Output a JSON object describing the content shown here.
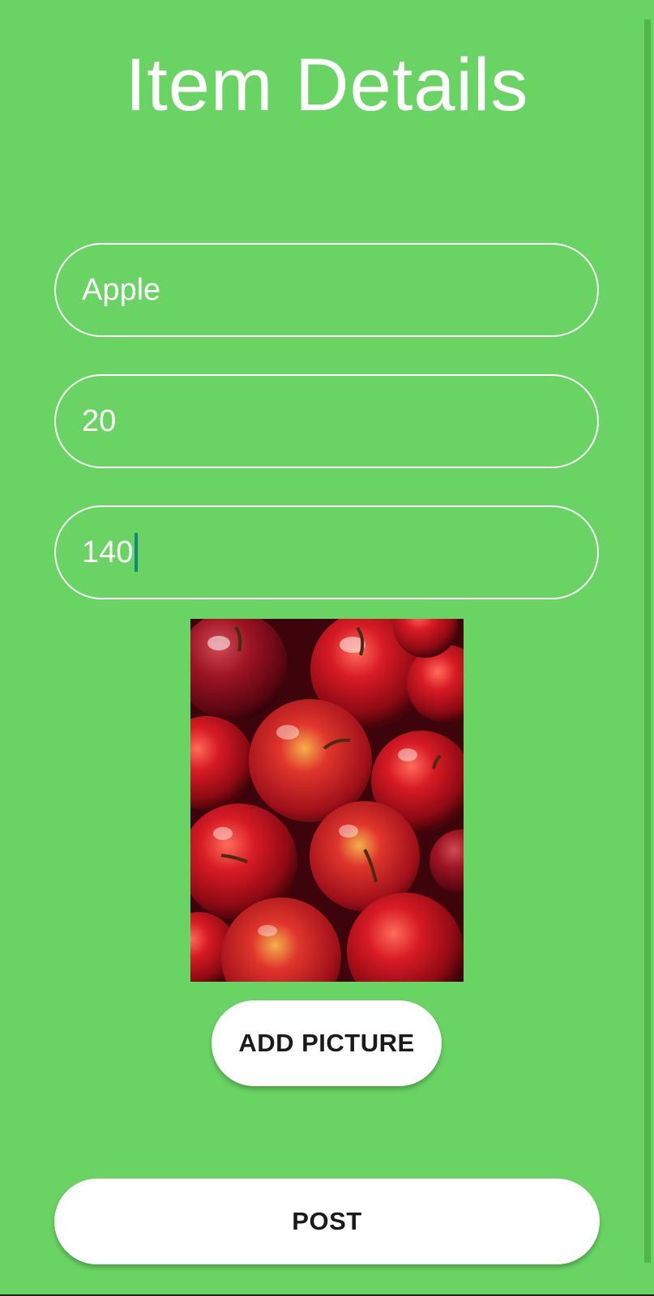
{
  "page": {
    "title": "Item Details",
    "background_color": "#69d463"
  },
  "form": {
    "name_value": "Apple",
    "quantity_value": "20",
    "price_value": "140"
  },
  "image": {
    "subject": "red apples photo"
  },
  "buttons": {
    "add_picture_label": "ADD PICTURE",
    "post_label": "POST"
  },
  "colors": {
    "accent": "#69d463",
    "button_bg": "#ffffff",
    "caret": "#0f8a78"
  }
}
